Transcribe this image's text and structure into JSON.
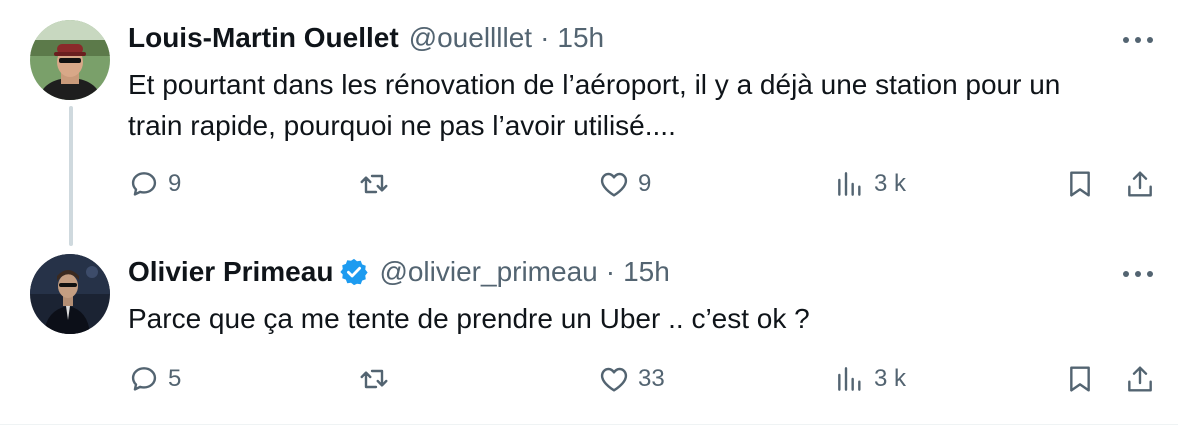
{
  "colors": {
    "text_primary": "#0f1419",
    "text_secondary": "#536471",
    "verified_blue": "#1d9bf0",
    "thread_line": "#cfd9de"
  },
  "tweets": [
    {
      "author_name": "Louis-Martin Ouellet",
      "handle": "@ouellllet",
      "separator": "·",
      "time": "15h",
      "verified": false,
      "text_lines": [
        "Et pourtant dans les rénovation de l’aéroport, il y a déjà une station pour un",
        "train rapide, pourquoi ne pas l’avoir utilisé...."
      ],
      "replies": "9",
      "reposts": "",
      "likes": "9",
      "views": "3 k"
    },
    {
      "author_name": "Olivier Primeau",
      "handle": "@olivier_primeau",
      "separator": "·",
      "time": "15h",
      "verified": true,
      "text_lines": [
        "Parce que ça me tente de prendre un Uber .. c’est ok ?"
      ],
      "replies": "5",
      "reposts": "",
      "likes": "33",
      "views": "3 k"
    }
  ]
}
